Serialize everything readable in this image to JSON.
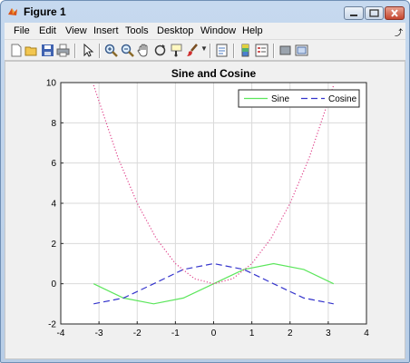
{
  "window": {
    "title": "Figure 1"
  },
  "menu": [
    "File",
    "Edit",
    "View",
    "Insert",
    "Tools",
    "Desktop",
    "Window",
    "Help"
  ],
  "toolbar": [
    "new-figure-icon",
    "open-file-icon",
    "save-icon",
    "print-icon",
    "edit-plot-icon",
    "zoom-in-icon",
    "zoom-out-icon",
    "pan-icon",
    "rotate-3d-icon",
    "data-cursor-icon",
    "brush-icon",
    "link-plot-icon",
    "colorbar-icon",
    "legend-icon",
    "hide-plot-tools-icon",
    "show-plot-tools-icon"
  ],
  "chart_data": {
    "type": "line",
    "title": "Sine and Cosine",
    "xlabel": "",
    "ylabel": "",
    "xlim": [
      -4,
      4
    ],
    "ylim": [
      -2,
      10
    ],
    "xticks": [
      "-4",
      "-3",
      "-2",
      "-1",
      "0",
      "1",
      "2",
      "3",
      "4"
    ],
    "yticks": [
      "-2",
      "0",
      "2",
      "4",
      "6",
      "8",
      "10"
    ],
    "grid": true,
    "legend": {
      "placement": "top-right",
      "entries": [
        "Sine",
        "Cosine"
      ]
    },
    "series": [
      {
        "name": "Sine",
        "color": "#5ce65c",
        "style": "solid",
        "x": [
          -3.14,
          -2.36,
          -1.57,
          -0.79,
          0,
          0.79,
          1.57,
          2.36,
          3.14
        ],
        "y": [
          0,
          -0.71,
          -1,
          -0.71,
          0,
          0.71,
          1,
          0.71,
          0
        ]
      },
      {
        "name": "Cosine",
        "color": "#3535cc",
        "style": "dashed",
        "x": [
          -3.14,
          -2.36,
          -1.57,
          -0.79,
          0,
          0.79,
          1.57,
          2.36,
          3.14
        ],
        "y": [
          -1,
          -0.71,
          0,
          0.71,
          1,
          0.71,
          0,
          -0.71,
          -1
        ]
      },
      {
        "color": "#e0408a",
        "style": "dotted",
        "x": [
          -3.14,
          -2.5,
          -2,
          -1.5,
          -1,
          -0.5,
          0,
          0.5,
          1,
          1.5,
          2,
          2.5,
          3.14
        ],
        "y": [
          9.87,
          6.25,
          4,
          2.25,
          1,
          0.25,
          0,
          0.25,
          1,
          2.25,
          4,
          6.25,
          9.87
        ]
      }
    ]
  }
}
